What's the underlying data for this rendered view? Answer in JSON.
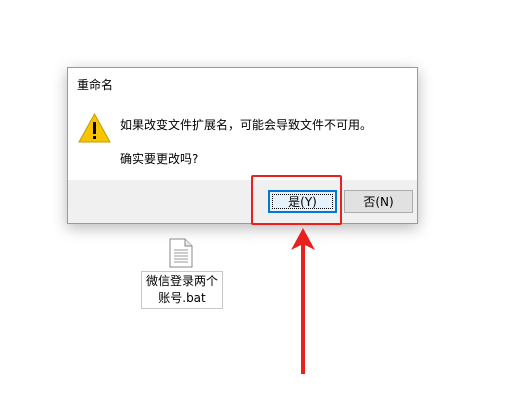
{
  "dialog": {
    "title": "重命名",
    "message_line1": "如果改变文件扩展名，可能会导致文件不可用。",
    "message_line2": "确实要更改吗?",
    "icon": "warning-icon",
    "yes_button": "是(Y)",
    "no_button": "否(N)"
  },
  "desktop_file": {
    "icon": "batch-file-icon",
    "name_line1": "微信登录两个",
    "name_line2": "账号.bat"
  },
  "annotation": {
    "highlight_color": "#e8201e",
    "arrow_color": "#e8201e"
  },
  "colors": {
    "dialog_footer": "#f0f0f0",
    "focus_border": "#0078d7",
    "warning_yellow": "#f6c500"
  }
}
